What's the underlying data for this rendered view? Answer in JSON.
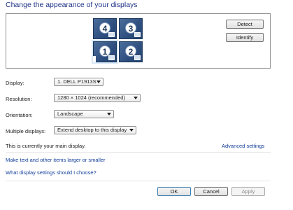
{
  "title": "Change the appearance of your displays",
  "monitors": [
    {
      "number": "4",
      "selected": false
    },
    {
      "number": "3",
      "selected": false
    },
    {
      "number": "1",
      "selected": true
    },
    {
      "number": "2",
      "selected": false
    }
  ],
  "buttons": {
    "detect": "Detect",
    "identify": "Identify",
    "ok": "OK",
    "cancel": "Cancel",
    "apply": "Apply"
  },
  "settings": {
    "display": {
      "label": "Display:",
      "value": "1. DELL P1913S"
    },
    "resolution": {
      "label": "Resolution:",
      "value": "1280 × 1024 (recommended)"
    },
    "orientation": {
      "label": "Orientation:",
      "value": "Landscape"
    },
    "multiple": {
      "label": "Multiple displays:",
      "value": "Extend desktop to this display"
    }
  },
  "status": "This is currently your main display.",
  "links": {
    "advanced": "Advanced settings",
    "text_size": "Make text and other items larger or smaller",
    "help": "What display settings should I choose?"
  }
}
